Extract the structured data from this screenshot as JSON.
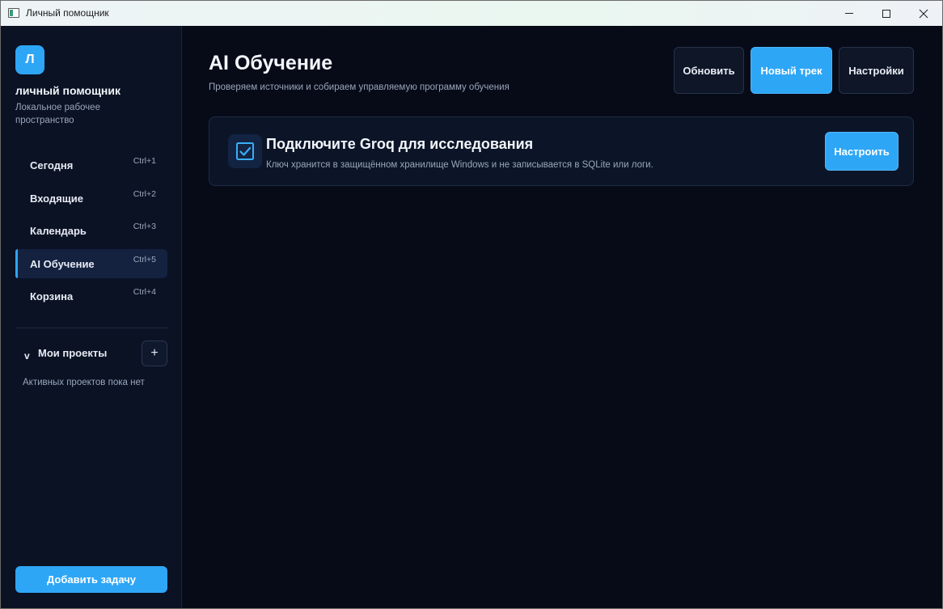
{
  "window": {
    "title": "Личный помощник"
  },
  "sidebar": {
    "logo_letter": "Л",
    "app_name": "личный помощник",
    "workspace": "Локальное рабочее пространство",
    "nav": [
      {
        "label": "Сегодня",
        "shortcut": "Ctrl+1",
        "active": false
      },
      {
        "label": "Входящие",
        "shortcut": "Ctrl+2",
        "active": false
      },
      {
        "label": "Календарь",
        "shortcut": "Ctrl+3",
        "active": false
      },
      {
        "label": "AI Обучение",
        "shortcut": "Ctrl+5",
        "active": true
      },
      {
        "label": "Корзина",
        "shortcut": "Ctrl+4",
        "active": false
      }
    ],
    "projects": {
      "chevron": "v",
      "title": "Мои проекты",
      "add_label": "+",
      "empty_text": "Активных проектов пока нет"
    },
    "add_task_label": "Добавить задачу"
  },
  "main": {
    "title": "AI Обучение",
    "subtitle": "Проверяем источники и собираем управляемую программу обучения",
    "buttons": {
      "refresh": "Обновить",
      "new_track": "Новый трек",
      "settings": "Настройки"
    },
    "banner": {
      "icon": "checkbox-icon",
      "title": "Подключите Groq для исследования",
      "text": "Ключ хранится в защищённом хранилище Windows и не записывается в SQLite или логи.",
      "button": "Настроить"
    }
  },
  "colors": {
    "accent": "#2ea6f6",
    "background": "#070b18",
    "sidebar": "#0a1224"
  }
}
